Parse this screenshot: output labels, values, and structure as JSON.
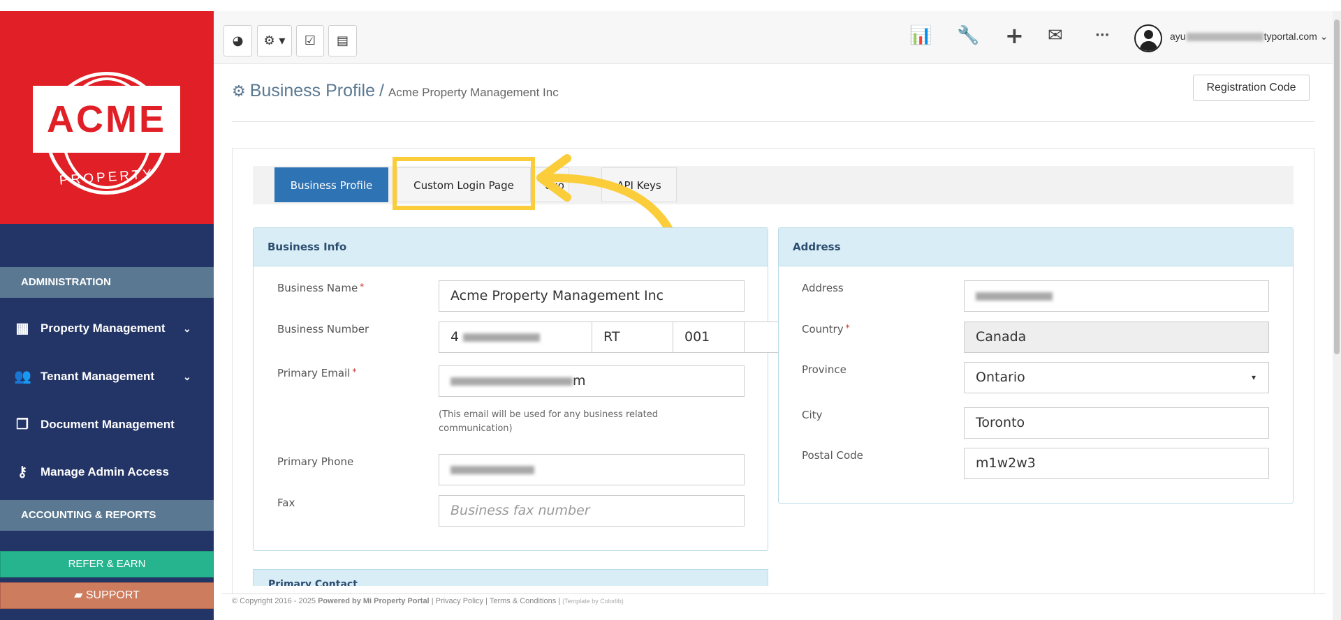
{
  "sidebar": {
    "logo_text": "ACME",
    "logo_sub": "PROPERTY",
    "section_admin": "ADMINISTRATION",
    "items": [
      {
        "label": "Property Management",
        "icon": "building-icon",
        "glyph": "▦",
        "has_chevron": true
      },
      {
        "label": "Tenant Management",
        "icon": "users-icon",
        "glyph": "👥",
        "has_chevron": true
      },
      {
        "label": "Document Management",
        "icon": "documents-icon",
        "glyph": "❐",
        "has_chevron": false
      },
      {
        "label": "Manage Admin Access",
        "icon": "key-icon",
        "glyph": "⚷",
        "has_chevron": false
      }
    ],
    "section_accounting": "ACCOUNTING & REPORTS",
    "refer_label": "REFER & EARN",
    "support_label": "SUPPORT",
    "chevron_glyph": "⌄"
  },
  "topbar": {
    "tool_buttons": [
      {
        "name": "dashboard-icon",
        "glyph": "◕"
      },
      {
        "name": "gear-dropdown-icon",
        "glyph": "⚙ ▾"
      },
      {
        "name": "calendar-check-icon",
        "glyph": "☑"
      },
      {
        "name": "calculator-icon",
        "glyph": "▤"
      }
    ],
    "icons": [
      {
        "name": "bar-chart-icon",
        "glyph": "📊"
      },
      {
        "name": "wrench-icon",
        "glyph": "🔧"
      },
      {
        "name": "plus-icon",
        "glyph": "+"
      },
      {
        "name": "envelope-icon",
        "glyph": "✉"
      },
      {
        "name": "more-icon",
        "glyph": "···"
      }
    ],
    "user_prefix": "ayu",
    "user_suffix": "typortal.com",
    "user_caret": "⌄"
  },
  "page": {
    "title": "Business Profile",
    "separator": "/",
    "subtitle": "Acme Property Management Inc",
    "registration_code": "Registration Code",
    "gear_glyph": "⚙"
  },
  "tabs": [
    {
      "label": "Business Profile",
      "active": true
    },
    {
      "label": "Custom Login Page",
      "active": false
    },
    {
      "label": "ogo",
      "active": false
    },
    {
      "label": "API Keys",
      "active": false
    }
  ],
  "business_info": {
    "heading": "Business Info",
    "name_label": "Business Name",
    "name_value": "Acme Property Management Inc",
    "number_label": "Business Number",
    "number_value_prefix": "4",
    "number_rt": "RT",
    "number_suffix": "001",
    "email_label": "Primary Email",
    "email_value_suffix": "m",
    "email_help": "(This email will be used for any business related communication)",
    "phone_label": "Primary Phone",
    "fax_label": "Fax",
    "fax_placeholder": "Business fax number",
    "required_mark": "*"
  },
  "address": {
    "heading": "Address",
    "address_label": "Address",
    "country_label": "Country",
    "country_value": "Canada",
    "province_label": "Province",
    "province_value": "Ontario",
    "city_label": "City",
    "city_value": "Toronto",
    "postal_label": "Postal Code",
    "postal_value": "m1w2w3",
    "caret_glyph": "▾"
  },
  "primary_contact_heading": "Primary Contact",
  "footer": {
    "copyright": "© Copyright 2016 - 2025",
    "powered": "Powered by Mi Property Portal",
    "links": "| Privacy Policy | Terms & Conditions |",
    "template": "(Template by Colorlib)"
  },
  "colors": {
    "logo_red": "#e02026",
    "sidebar_navy": "#233466",
    "active_tab_blue": "#2e73b4",
    "highlight_yellow": "#fbcd3b",
    "refer_green": "#26b48f",
    "support_orange": "#cd7c5e"
  },
  "annotation": {
    "highlight": "Custom Login Page tab highlighted",
    "arrow_icon": "curved-arrow-icon"
  }
}
